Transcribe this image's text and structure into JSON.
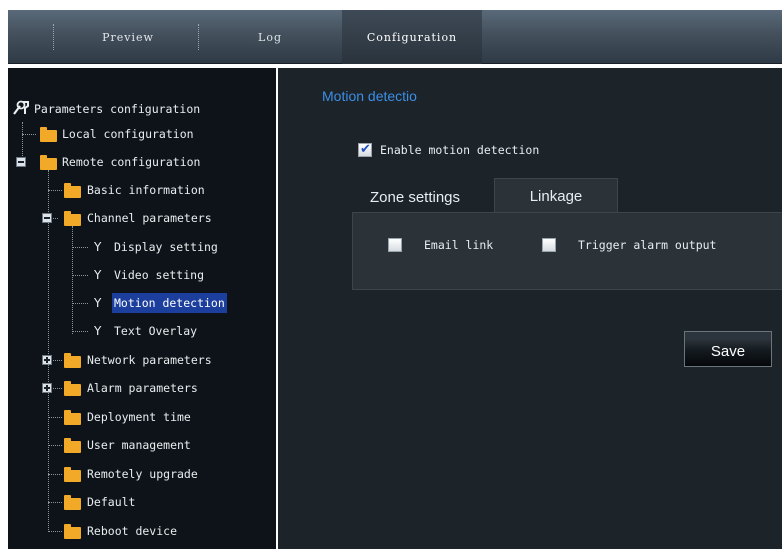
{
  "nav": {
    "tabs": [
      {
        "label": "Preview"
      },
      {
        "label": "Log"
      },
      {
        "label": "Configuration"
      }
    ],
    "active_tab": "Configuration"
  },
  "tree": {
    "root": "Parameters configuration",
    "items": [
      {
        "label": "Local configuration",
        "icon": "folder-icon"
      },
      {
        "label": "Remote configuration",
        "icon": "folder-icon"
      },
      {
        "label": "Basic information",
        "icon": "folder-icon"
      },
      {
        "label": "Channel parameters",
        "icon": "folder-icon"
      },
      {
        "label": "Display setting",
        "icon": "wrench-icon"
      },
      {
        "label": "Video setting",
        "icon": "wrench-icon"
      },
      {
        "label": "Motion detection",
        "icon": "wrench-icon",
        "selected": true
      },
      {
        "label": "Text Overlay",
        "icon": "wrench-icon"
      },
      {
        "label": "Network parameters",
        "icon": "folder-icon"
      },
      {
        "label": "Alarm parameters",
        "icon": "folder-icon"
      },
      {
        "label": "Deployment time",
        "icon": "folder-icon"
      },
      {
        "label": "User management",
        "icon": "folder-icon"
      },
      {
        "label": "Remotely upgrade",
        "icon": "folder-icon"
      },
      {
        "label": "Default",
        "icon": "folder-icon"
      },
      {
        "label": "Reboot device",
        "icon": "folder-icon"
      }
    ]
  },
  "content": {
    "title": "Motion detectio",
    "enable_label": "Enable motion detection",
    "enable_checked": true,
    "tabs": [
      {
        "label": "Zone settings",
        "active": false
      },
      {
        "label": "Linkage",
        "active": true
      }
    ],
    "linkage": {
      "email_label": "Email link",
      "email_checked": false,
      "alarm_label": "Trigger alarm output",
      "alarm_checked": false
    },
    "save_label": "Save"
  },
  "colors": {
    "accent_title": "#3c8ee6",
    "selection": "#1c3f9e",
    "folder": "#f2a928"
  }
}
